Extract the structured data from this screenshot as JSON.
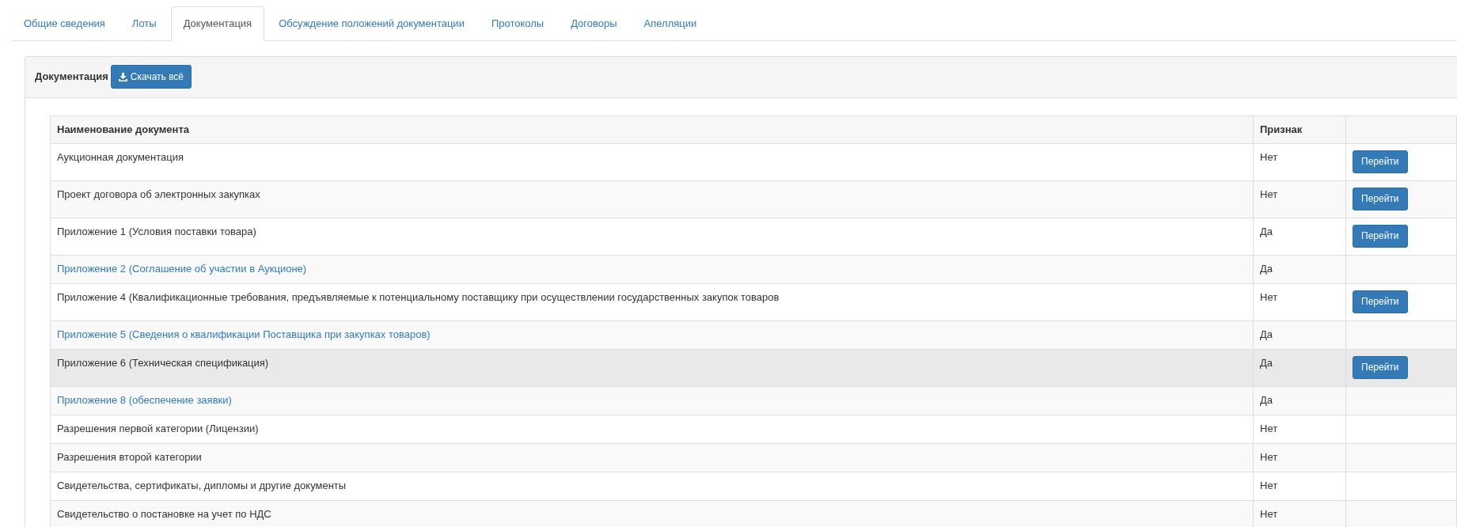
{
  "tabs": [
    {
      "label": "Общие сведения",
      "selected": false
    },
    {
      "label": "Лоты",
      "selected": false
    },
    {
      "label": "Документация",
      "selected": true
    },
    {
      "label": "Обсуждение положений документации",
      "selected": false
    },
    {
      "label": "Протоколы",
      "selected": false
    },
    {
      "label": "Договоры",
      "selected": false
    },
    {
      "label": "Апелляции",
      "selected": false
    }
  ],
  "panel": {
    "title": "Документация",
    "download_button": "Скачать всё"
  },
  "table": {
    "columns": [
      "Наименование документа",
      "Признак"
    ],
    "rows": [
      {
        "name": "Аукционная документация",
        "link": false,
        "flag": "Нет",
        "action": "Перейти",
        "hovered": false
      },
      {
        "name": "Проект договора об электронных закупках",
        "link": false,
        "flag": "Нет",
        "action": "Перейти",
        "hovered": false
      },
      {
        "name": "Приложение 1 (Условия поставки товара)",
        "link": false,
        "flag": "Да",
        "action": "Перейти",
        "hovered": false
      },
      {
        "name": "Приложение 2 (Соглашение об участии в Аукционе)",
        "link": true,
        "flag": "Да",
        "hovered": false
      },
      {
        "name": "Приложение 4 (Квалификационные требования, предъявляемые к потенциальному поставщику при осуществлении государственных закупок товаров",
        "link": false,
        "flag": "Нет",
        "action": "Перейти",
        "hovered": false
      },
      {
        "name": "Приложение 5 (Сведения о квалификации Поставщика при закупках товаров)",
        "link": true,
        "flag": "Да",
        "hovered": false
      },
      {
        "name": "Приложение 6 (Техническая спецификация)",
        "link": false,
        "flag": "Да",
        "action": "Перейти",
        "hovered": true
      },
      {
        "name": "Приложение 8 (обеспечение заявки)",
        "link": true,
        "flag": "Да",
        "hovered": false
      },
      {
        "name": "Разрешения первой категории (Лицензии)",
        "link": false,
        "flag": "Нет",
        "hovered": false
      },
      {
        "name": "Разрешения второй категории",
        "link": false,
        "flag": "Нет",
        "hovered": false
      },
      {
        "name": "Свидетельства, сертификаты, дипломы и другие документы",
        "link": false,
        "flag": "Нет",
        "hovered": false
      },
      {
        "name": "Свидетельство о постановке на учет по НДС",
        "link": false,
        "flag": "Нет",
        "hovered": false
      }
    ]
  }
}
